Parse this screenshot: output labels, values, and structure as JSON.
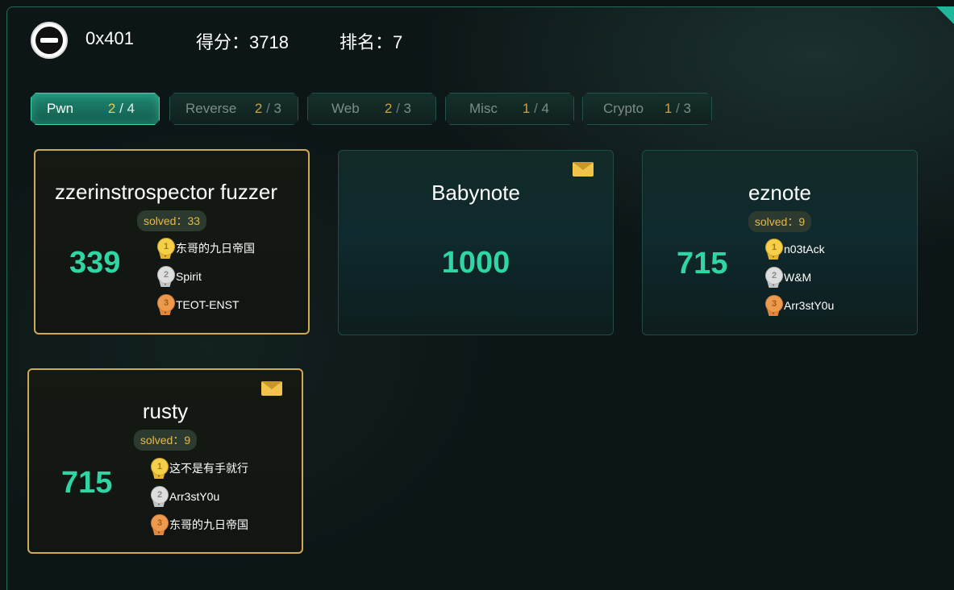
{
  "header": {
    "team_name": "0x401",
    "score_text": "得分：3718",
    "rank_text": "排名：7"
  },
  "tabs": [
    {
      "name": "Pwn",
      "solved": "2",
      "sep": " / ",
      "total": "4",
      "active": true
    },
    {
      "name": "Reverse",
      "solved": "2",
      "sep": " / ",
      "total": "3",
      "active": false
    },
    {
      "name": "Web",
      "solved": "2",
      "sep": " / ",
      "total": "3",
      "active": false
    },
    {
      "name": "Misc",
      "solved": "1",
      "sep": " / ",
      "total": "4",
      "active": false
    },
    {
      "name": "Crypto",
      "solved": "1",
      "sep": " / ",
      "total": "3",
      "active": false
    }
  ],
  "challenges": [
    {
      "title": "zzerinstrospector fuzzer",
      "solved_text": "solved：33",
      "points": "339",
      "solved_by_me": true,
      "has_mail": false,
      "bloods": [
        "东哥的九日帝国",
        "Spirit",
        "TEOT-ENST"
      ]
    },
    {
      "title": "Babynote",
      "solved_text": "",
      "points": "1000",
      "solved_by_me": false,
      "has_mail": true,
      "bloods": []
    },
    {
      "title": "eznote",
      "solved_text": "solved：9",
      "points": "715",
      "solved_by_me": false,
      "has_mail": false,
      "bloods": [
        "n03tAck",
        "W&M",
        "Arr3stY0u"
      ]
    },
    {
      "title": "rusty",
      "solved_text": "solved：9",
      "points": "715",
      "solved_by_me": true,
      "has_mail": true,
      "bloods": [
        "这不是有手就行",
        "Arr3stY0u",
        "东哥的九日帝国"
      ]
    }
  ],
  "medal_numbers": [
    "1",
    "2",
    "3"
  ],
  "colors": {
    "accent_teal": "#2fd6a4",
    "gold_border": "#d0a955",
    "solved_text": "#e3b94f"
  }
}
